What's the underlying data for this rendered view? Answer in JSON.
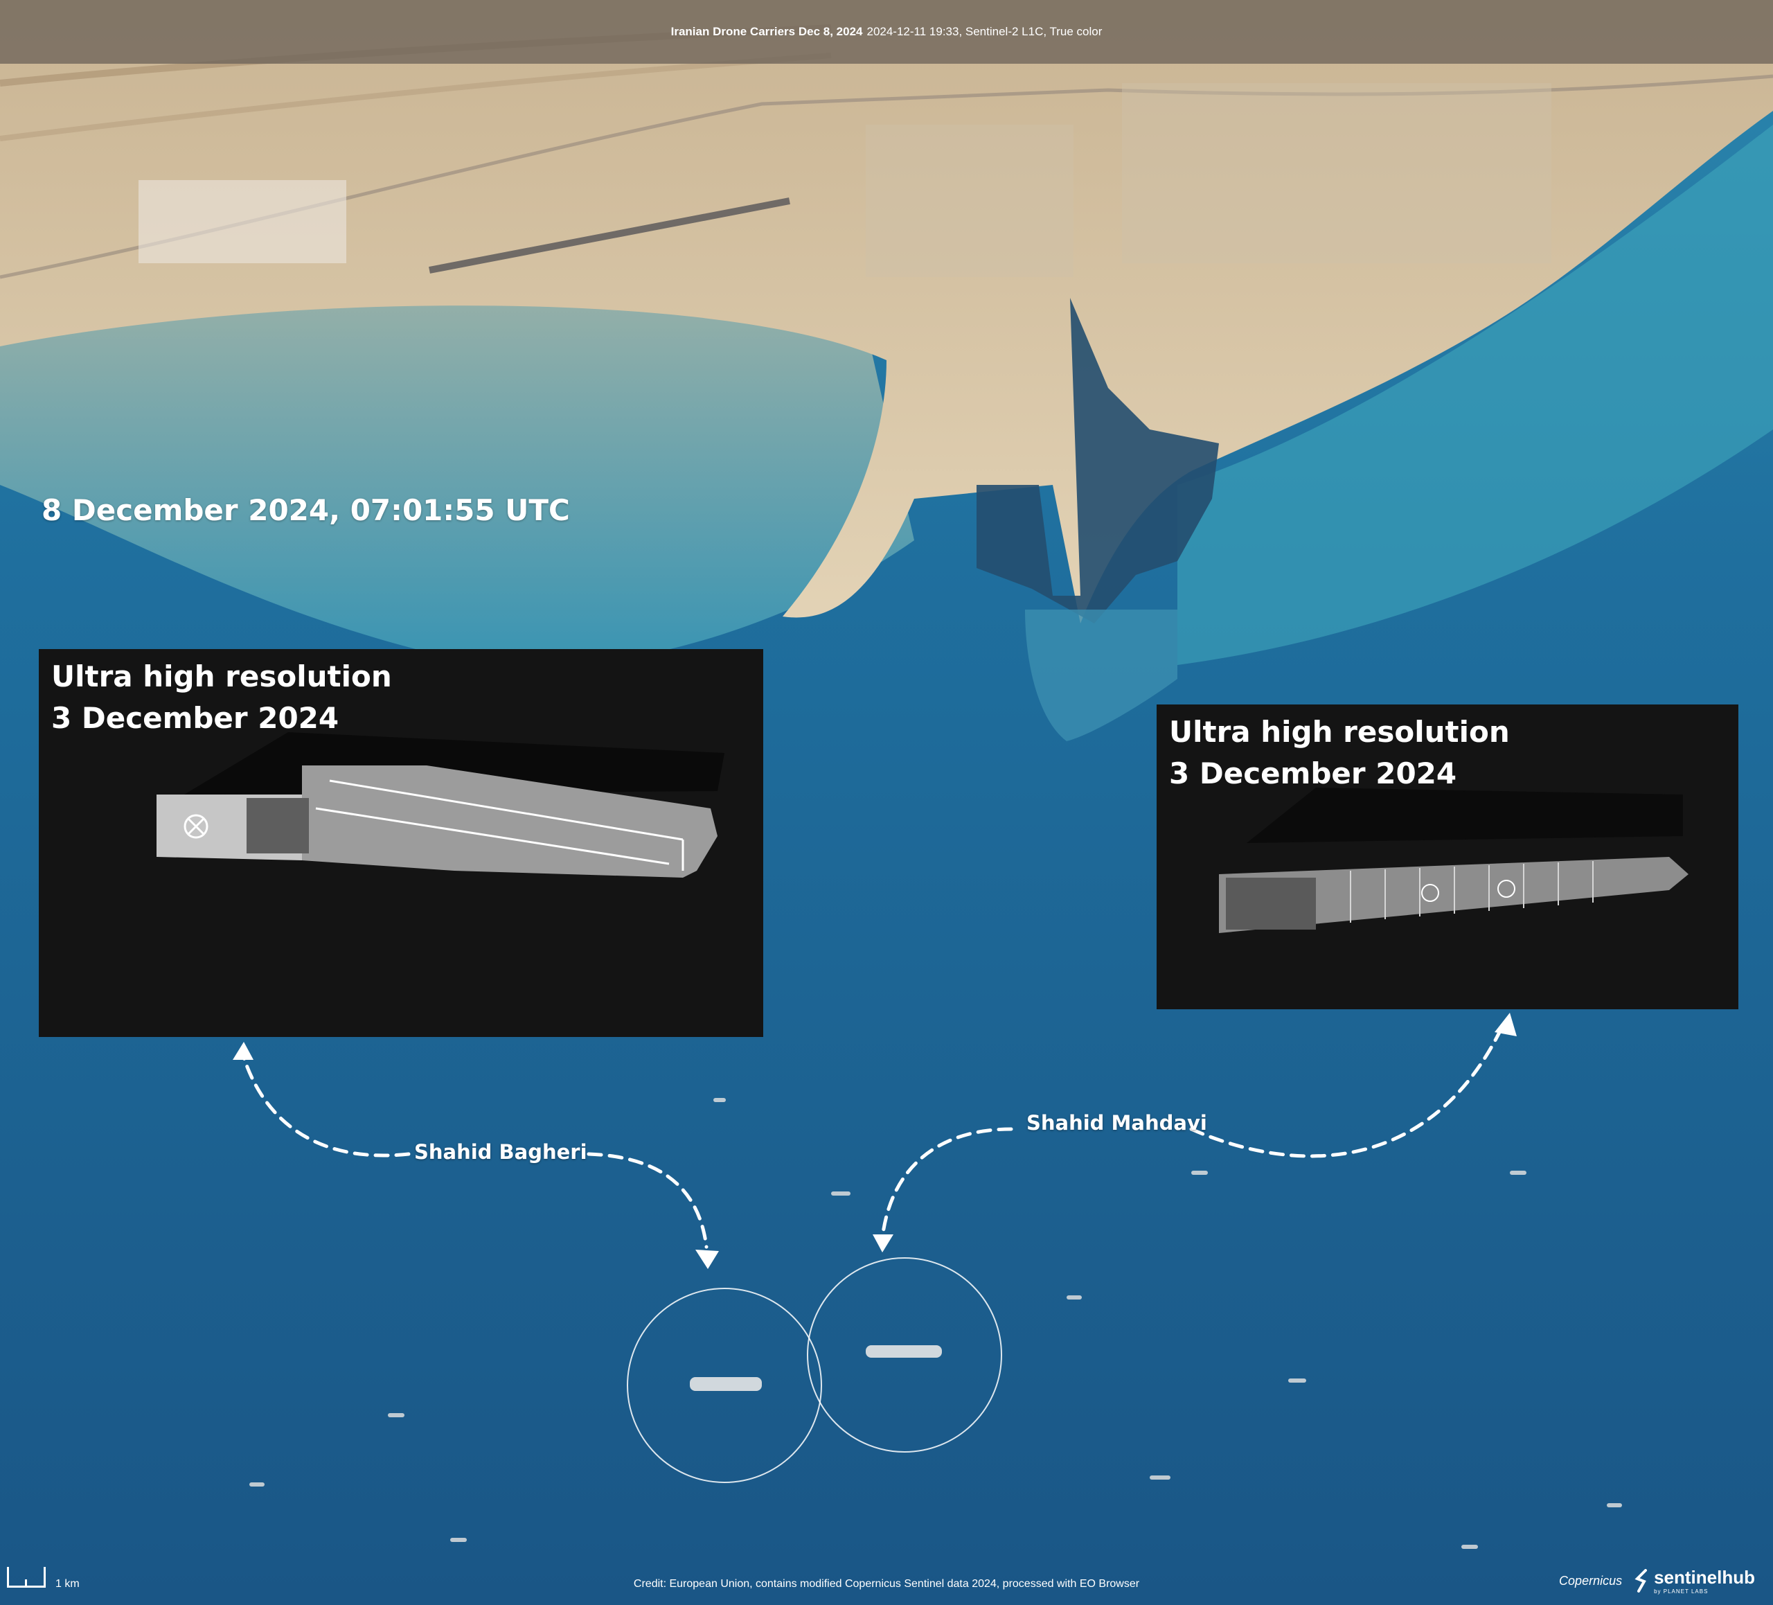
{
  "header": {
    "title_bold": "Iranian Drone Carriers Dec 8, 2024",
    "title_rest": "2024-12-11 19:33, Sentinel-2 L1C, True color"
  },
  "date_stamp": "8 December 2024, 07:01:55 UTC",
  "insets": [
    {
      "line1": "Ultra high resolution",
      "line2": "3 December 2024"
    },
    {
      "line1": "Ultra high resolution",
      "line2": "3 December 2024"
    }
  ],
  "ships": {
    "left_label": "Shahid Bagheri",
    "right_label": "Shahid Mahdavi"
  },
  "footer": {
    "scale_label": "1 km",
    "credit": "Credit: European Union, contains modified Copernicus Sentinel data 2024, processed with EO Browser",
    "copernicus": "Copernicus",
    "sentinelhub": "sentinelhub",
    "sentinelhub_sub": "by PLANET LABS"
  }
}
